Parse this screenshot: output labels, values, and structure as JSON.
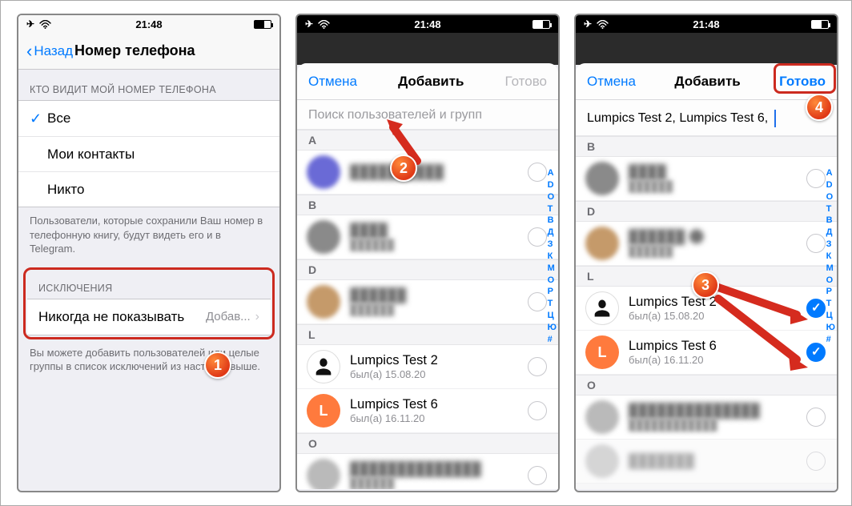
{
  "status": {
    "time": "21:48"
  },
  "p1": {
    "back": "Назад",
    "title": "Номер телефона",
    "sec1_header": "КТО ВИДИТ МОЙ НОМЕР ТЕЛЕФОНА",
    "options": {
      "all": "Все",
      "contacts": "Мои контакты",
      "nobody": "Никто"
    },
    "sec1_footer": "Пользователи, которые сохранили Ваш номер в телефонную книгу, будут видеть его и в Telegram.",
    "sec2_header": "ИСКЛЮЧЕНИЯ",
    "never_label": "Никогда не показывать",
    "never_value": "Добав...",
    "sec2_footer": "Вы можете добавить пользователей или целые группы в список исключений из настроек выше."
  },
  "sheet": {
    "cancel": "Отмена",
    "title": "Добавить",
    "done": "Готово",
    "search_placeholder": "Поиск пользователей и групп",
    "tokens": "Lumpics Test 2,  Lumpics Test 6,",
    "letters": {
      "A": "A",
      "B": "B",
      "D": "D",
      "L": "L",
      "O": "O"
    },
    "contacts": {
      "lt2": {
        "name": "Lumpics Test 2",
        "sub": "был(а) 15.08.20"
      },
      "lt6": {
        "name": "Lumpics Test 6",
        "sub": "был(а) 16.11.20"
      },
      "lt6_avatar": "L"
    },
    "index": [
      "A",
      "D",
      "O",
      "Т",
      "В",
      "Д",
      "З",
      "К",
      "М",
      "О",
      "Р",
      "Т",
      "Ц",
      "Ю",
      "#"
    ]
  },
  "badges": {
    "b1": "1",
    "b2": "2",
    "b3": "3",
    "b4": "4"
  }
}
